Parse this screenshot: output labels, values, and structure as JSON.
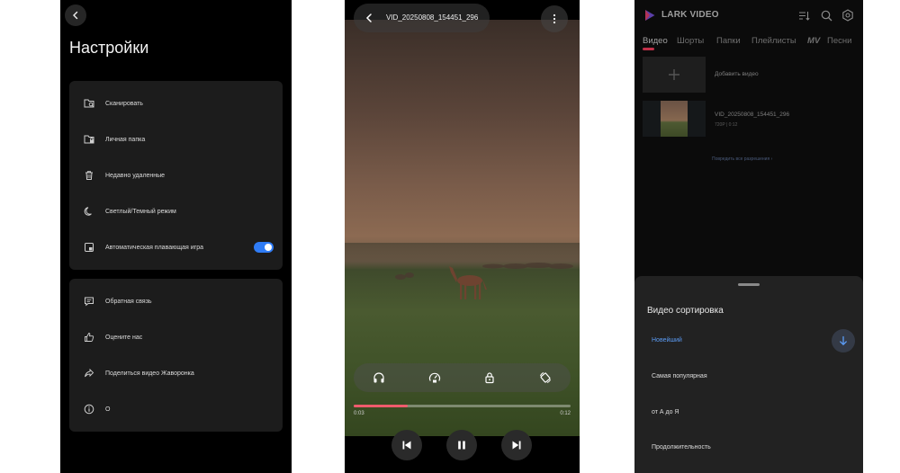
{
  "settings": {
    "title": "Настройки",
    "group1": [
      {
        "label": "Сканировать",
        "icon": "folder-search-icon"
      },
      {
        "label": "Личная папка",
        "icon": "folder-lock-icon"
      },
      {
        "label": "Недавно удаленные",
        "icon": "trash-icon"
      },
      {
        "label": "Светлый/Темный режим",
        "icon": "moon-icon"
      },
      {
        "label": "Автоматическая плавающая игра",
        "icon": "floating-window-icon",
        "toggle_on": true
      }
    ],
    "group2": [
      {
        "label": "Обратная связь",
        "icon": "feedback-icon"
      },
      {
        "label": "Оцените нас",
        "icon": "thumbs-up-icon"
      },
      {
        "label": "Поделиться видео Жаворонка",
        "icon": "share-icon"
      },
      {
        "label": "О",
        "icon": "info-icon"
      }
    ]
  },
  "player": {
    "title": "VID_20250808_154451_296",
    "current_time": "0:03",
    "total_time": "0:12",
    "progress": 0.25,
    "accent_color": "#ef5b6c",
    "controls": [
      "headphones-icon",
      "speed-icon",
      "lock-icon",
      "rotate-icon"
    ]
  },
  "app": {
    "brand": "LARK VIDEO",
    "tabs": [
      "Видео",
      "Шорты",
      "Папки",
      "Плейлисты",
      "MV",
      "Песни"
    ],
    "active_tab": "Видео",
    "add_video_label": "Добавить видео",
    "video_name": "VID_20250808_154451_296",
    "video_meta": "720P | 0:12",
    "resolution_link": "Повредить все разрешения",
    "accent_color": "#c2314a"
  },
  "sort_sheet": {
    "title": "Видео сортировка",
    "options": [
      "Новейший",
      "Самая популярная",
      "от А до Я",
      "Продолжительность"
    ],
    "selected": "Новейший",
    "selected_color": "#5b9cf5"
  }
}
